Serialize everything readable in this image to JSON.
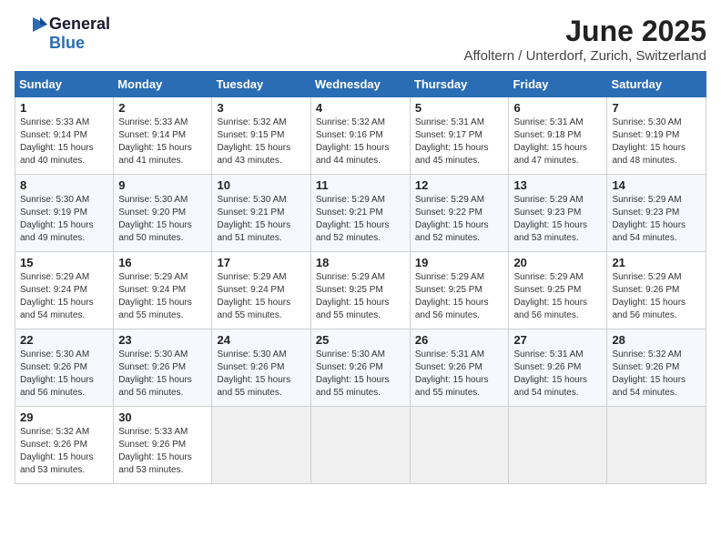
{
  "header": {
    "logo_general": "General",
    "logo_blue": "Blue",
    "month_title": "June 2025",
    "location": "Affoltern / Unterdorf, Zurich, Switzerland"
  },
  "days_of_week": [
    "Sunday",
    "Monday",
    "Tuesday",
    "Wednesday",
    "Thursday",
    "Friday",
    "Saturday"
  ],
  "weeks": [
    [
      {
        "day": "1",
        "sunrise": "5:33 AM",
        "sunset": "9:14 PM",
        "daylight": "15 hours and 40 minutes."
      },
      {
        "day": "2",
        "sunrise": "5:33 AM",
        "sunset": "9:14 PM",
        "daylight": "15 hours and 41 minutes."
      },
      {
        "day": "3",
        "sunrise": "5:32 AM",
        "sunset": "9:15 PM",
        "daylight": "15 hours and 43 minutes."
      },
      {
        "day": "4",
        "sunrise": "5:32 AM",
        "sunset": "9:16 PM",
        "daylight": "15 hours and 44 minutes."
      },
      {
        "day": "5",
        "sunrise": "5:31 AM",
        "sunset": "9:17 PM",
        "daylight": "15 hours and 45 minutes."
      },
      {
        "day": "6",
        "sunrise": "5:31 AM",
        "sunset": "9:18 PM",
        "daylight": "15 hours and 47 minutes."
      },
      {
        "day": "7",
        "sunrise": "5:30 AM",
        "sunset": "9:19 PM",
        "daylight": "15 hours and 48 minutes."
      }
    ],
    [
      {
        "day": "8",
        "sunrise": "5:30 AM",
        "sunset": "9:19 PM",
        "daylight": "15 hours and 49 minutes."
      },
      {
        "day": "9",
        "sunrise": "5:30 AM",
        "sunset": "9:20 PM",
        "daylight": "15 hours and 50 minutes."
      },
      {
        "day": "10",
        "sunrise": "5:30 AM",
        "sunset": "9:21 PM",
        "daylight": "15 hours and 51 minutes."
      },
      {
        "day": "11",
        "sunrise": "5:29 AM",
        "sunset": "9:21 PM",
        "daylight": "15 hours and 52 minutes."
      },
      {
        "day": "12",
        "sunrise": "5:29 AM",
        "sunset": "9:22 PM",
        "daylight": "15 hours and 52 minutes."
      },
      {
        "day": "13",
        "sunrise": "5:29 AM",
        "sunset": "9:23 PM",
        "daylight": "15 hours and 53 minutes."
      },
      {
        "day": "14",
        "sunrise": "5:29 AM",
        "sunset": "9:23 PM",
        "daylight": "15 hours and 54 minutes."
      }
    ],
    [
      {
        "day": "15",
        "sunrise": "5:29 AM",
        "sunset": "9:24 PM",
        "daylight": "15 hours and 54 minutes."
      },
      {
        "day": "16",
        "sunrise": "5:29 AM",
        "sunset": "9:24 PM",
        "daylight": "15 hours and 55 minutes."
      },
      {
        "day": "17",
        "sunrise": "5:29 AM",
        "sunset": "9:24 PM",
        "daylight": "15 hours and 55 minutes."
      },
      {
        "day": "18",
        "sunrise": "5:29 AM",
        "sunset": "9:25 PM",
        "daylight": "15 hours and 55 minutes."
      },
      {
        "day": "19",
        "sunrise": "5:29 AM",
        "sunset": "9:25 PM",
        "daylight": "15 hours and 56 minutes."
      },
      {
        "day": "20",
        "sunrise": "5:29 AM",
        "sunset": "9:25 PM",
        "daylight": "15 hours and 56 minutes."
      },
      {
        "day": "21",
        "sunrise": "5:29 AM",
        "sunset": "9:26 PM",
        "daylight": "15 hours and 56 minutes."
      }
    ],
    [
      {
        "day": "22",
        "sunrise": "5:30 AM",
        "sunset": "9:26 PM",
        "daylight": "15 hours and 56 minutes."
      },
      {
        "day": "23",
        "sunrise": "5:30 AM",
        "sunset": "9:26 PM",
        "daylight": "15 hours and 56 minutes."
      },
      {
        "day": "24",
        "sunrise": "5:30 AM",
        "sunset": "9:26 PM",
        "daylight": "15 hours and 55 minutes."
      },
      {
        "day": "25",
        "sunrise": "5:30 AM",
        "sunset": "9:26 PM",
        "daylight": "15 hours and 55 minutes."
      },
      {
        "day": "26",
        "sunrise": "5:31 AM",
        "sunset": "9:26 PM",
        "daylight": "15 hours and 55 minutes."
      },
      {
        "day": "27",
        "sunrise": "5:31 AM",
        "sunset": "9:26 PM",
        "daylight": "15 hours and 54 minutes."
      },
      {
        "day": "28",
        "sunrise": "5:32 AM",
        "sunset": "9:26 PM",
        "daylight": "15 hours and 54 minutes."
      }
    ],
    [
      {
        "day": "29",
        "sunrise": "5:32 AM",
        "sunset": "9:26 PM",
        "daylight": "15 hours and 53 minutes."
      },
      {
        "day": "30",
        "sunrise": "5:33 AM",
        "sunset": "9:26 PM",
        "daylight": "15 hours and 53 minutes."
      },
      null,
      null,
      null,
      null,
      null
    ]
  ]
}
